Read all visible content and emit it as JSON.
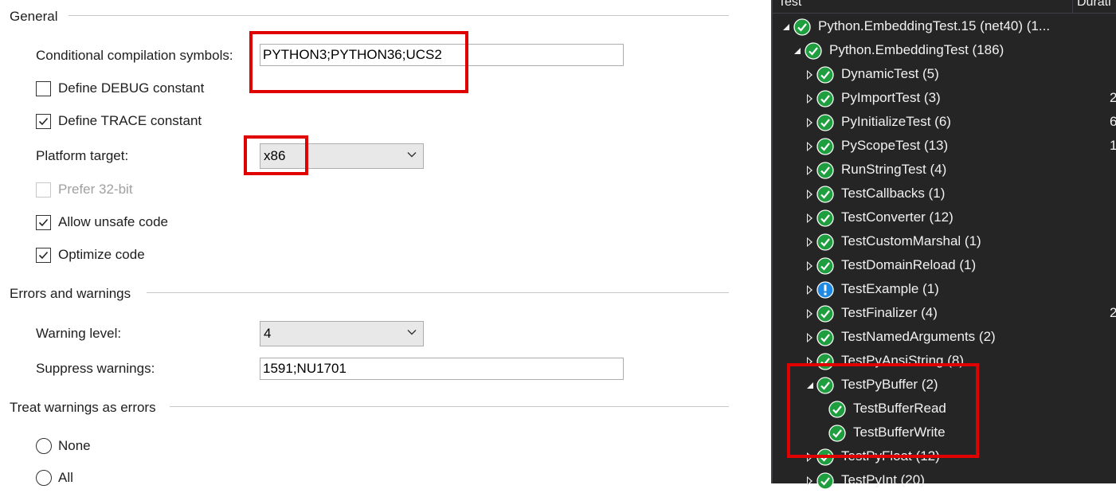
{
  "left_panel": {
    "general": {
      "title": "General",
      "conditional_symbols_label": "Conditional compilation symbols:",
      "conditional_symbols_value": "PYTHON3;PYTHON36;UCS2",
      "define_debug": {
        "label": "Define DEBUG constant",
        "checked": false
      },
      "define_trace": {
        "label": "Define TRACE constant",
        "checked": true
      },
      "platform_target_label": "Platform target:",
      "platform_target_value": "x86",
      "prefer_32bit": {
        "label": "Prefer 32-bit",
        "checked": false,
        "disabled": true
      },
      "allow_unsafe": {
        "label": "Allow unsafe code",
        "checked": true
      },
      "optimize": {
        "label": "Optimize code",
        "checked": true
      }
    },
    "errors": {
      "title": "Errors and warnings",
      "warning_level_label": "Warning level:",
      "warning_level_value": "4",
      "suppress_label": "Suppress warnings:",
      "suppress_value": "1591;NU1701"
    },
    "treat_warnings": {
      "title": "Treat warnings as errors",
      "none_label": "None",
      "all_label": "All"
    }
  },
  "test_explorer": {
    "header": {
      "test_col": "Test",
      "duration_col": "Durati"
    },
    "colors": {
      "pass": "#1e9e3e",
      "warn": "#1e88e5",
      "highlight": "#e00000"
    },
    "rows": [
      {
        "label": "Python.EmbeddingTest.15 (net40)  (1...",
        "status": "pass",
        "expander": "expanded",
        "level": 0,
        "duration": ""
      },
      {
        "label": "Python.EmbeddingTest  (186)",
        "status": "pass",
        "expander": "expanded",
        "level": 1,
        "duration": ""
      },
      {
        "label": "DynamicTest  (5)",
        "status": "pass",
        "expander": "collapsed",
        "level": 2,
        "duration": ""
      },
      {
        "label": "PyImportTest  (3)",
        "status": "pass",
        "expander": "collapsed",
        "level": 2,
        "duration": "2"
      },
      {
        "label": "PyInitializeTest  (6)",
        "status": "pass",
        "expander": "collapsed",
        "level": 2,
        "duration": "6"
      },
      {
        "label": "PyScopeTest  (13)",
        "status": "pass",
        "expander": "collapsed",
        "level": 2,
        "duration": "1"
      },
      {
        "label": "RunStringTest  (4)",
        "status": "pass",
        "expander": "collapsed",
        "level": 2,
        "duration": ""
      },
      {
        "label": "TestCallbacks  (1)",
        "status": "pass",
        "expander": "collapsed",
        "level": 2,
        "duration": ""
      },
      {
        "label": "TestConverter  (12)",
        "status": "pass",
        "expander": "collapsed",
        "level": 2,
        "duration": ""
      },
      {
        "label": "TestCustomMarshal  (1)",
        "status": "pass",
        "expander": "collapsed",
        "level": 2,
        "duration": ""
      },
      {
        "label": "TestDomainReload  (1)",
        "status": "pass",
        "expander": "collapsed",
        "level": 2,
        "duration": ""
      },
      {
        "label": "TestExample  (1)",
        "status": "warn",
        "expander": "collapsed",
        "level": 2,
        "duration": ""
      },
      {
        "label": "TestFinalizer  (4)",
        "status": "pass",
        "expander": "collapsed",
        "level": 2,
        "duration": "2"
      },
      {
        "label": "TestNamedArguments  (2)",
        "status": "pass",
        "expander": "collapsed",
        "level": 2,
        "duration": ""
      },
      {
        "label": "TestPyAnsiString  (8)",
        "status": "pass",
        "expander": "collapsed",
        "level": 2,
        "duration": ""
      },
      {
        "label": "TestPyBuffer  (2)",
        "status": "pass",
        "expander": "expanded",
        "level": 2,
        "duration": ""
      },
      {
        "label": "TestBufferRead",
        "status": "pass",
        "expander": "none",
        "level": 3,
        "duration": ""
      },
      {
        "label": "TestBufferWrite",
        "status": "pass",
        "expander": "none",
        "level": 3,
        "duration": ""
      },
      {
        "label": "TestPyFloat  (12)",
        "status": "pass",
        "expander": "collapsed",
        "level": 2,
        "duration": ""
      },
      {
        "label": "TestPyInt  (20)",
        "status": "pass",
        "expander": "collapsed",
        "level": 2,
        "duration": ""
      }
    ]
  }
}
